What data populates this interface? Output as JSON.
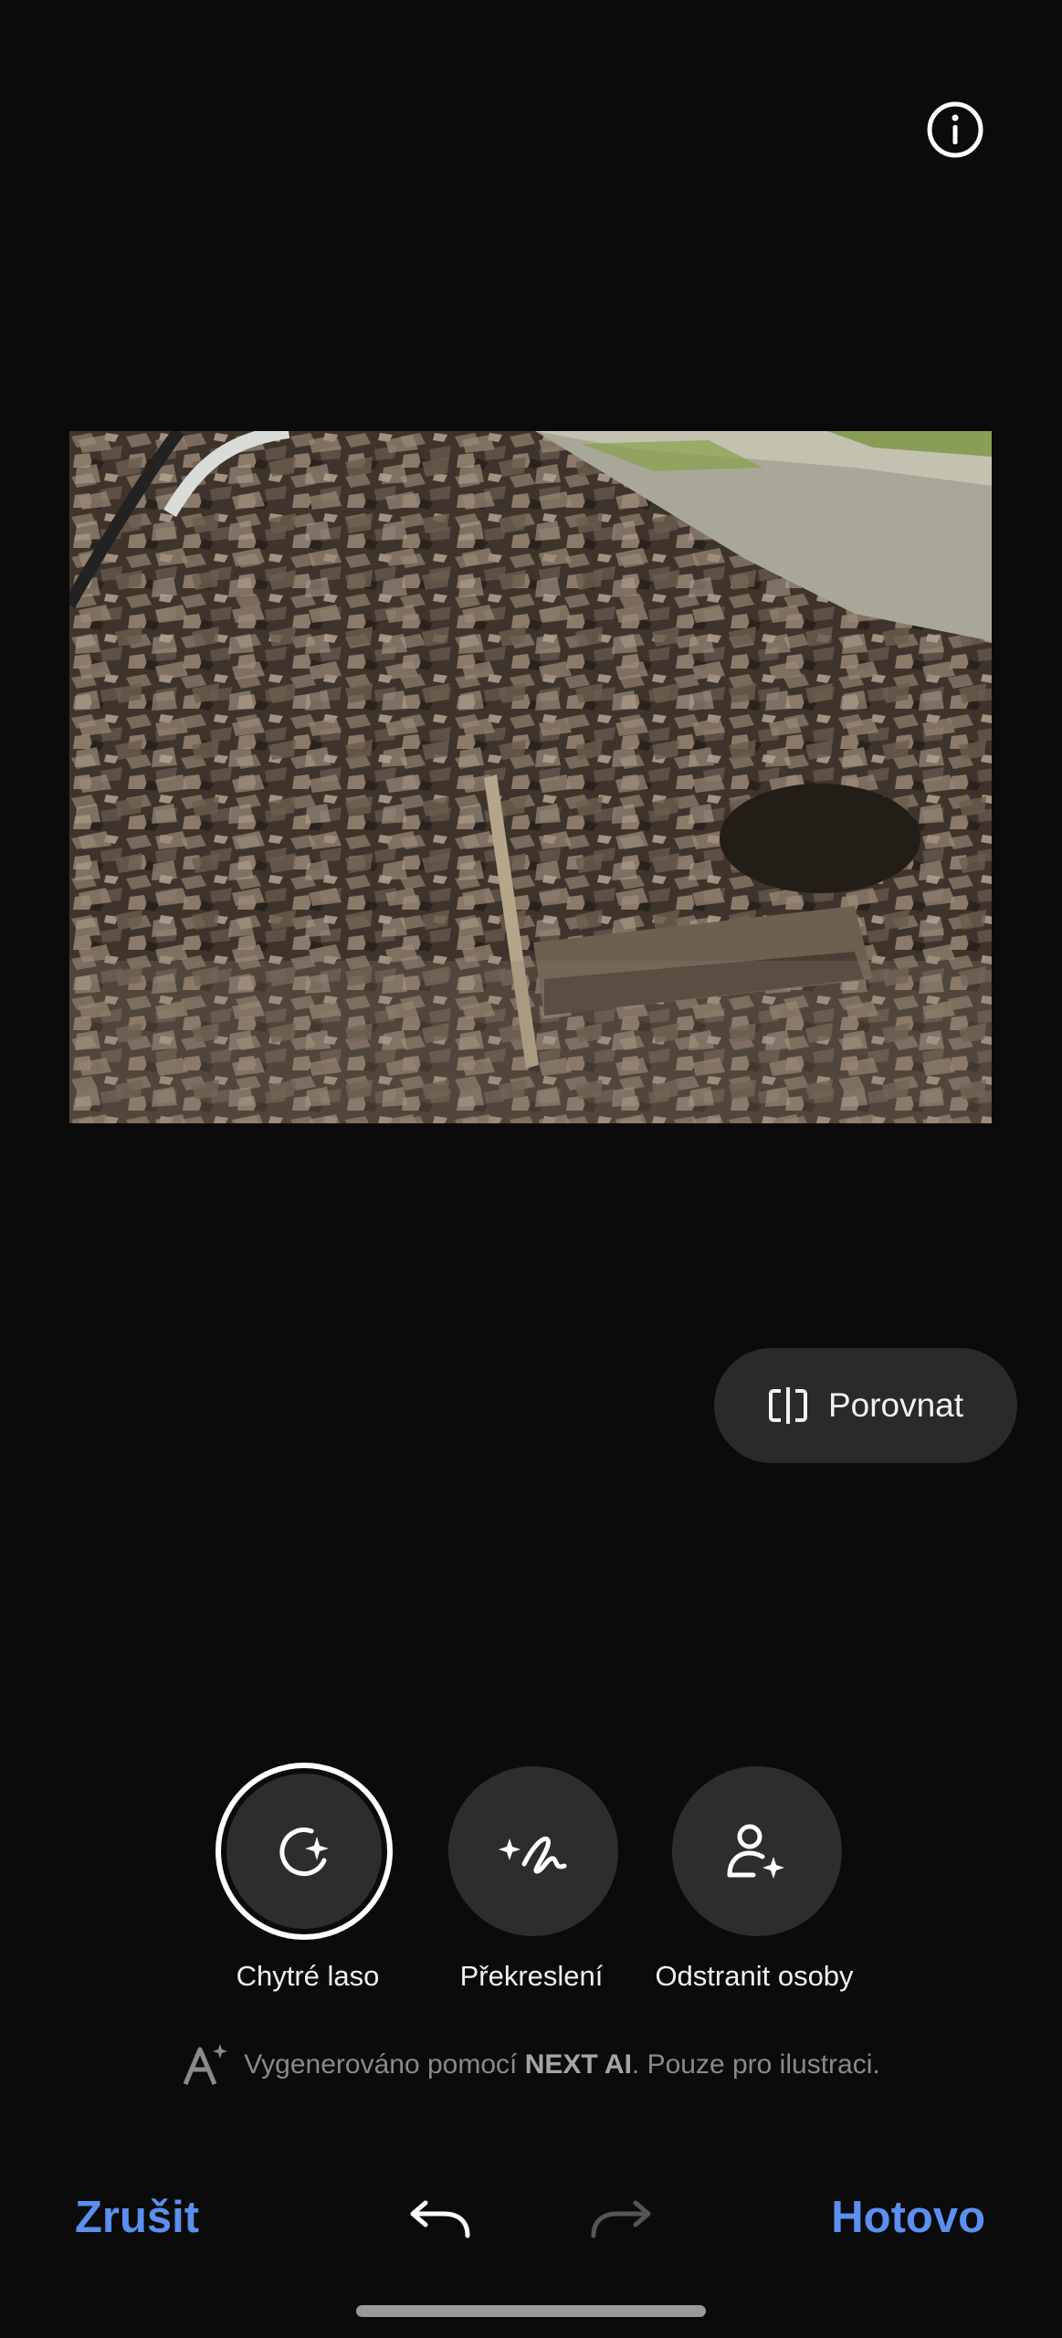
{
  "header": {
    "info_icon": "info-circle-icon"
  },
  "photo": {
    "description_icon": "photo"
  },
  "compare": {
    "label": "Porovnat",
    "icon": "compare-split-icon"
  },
  "tools": [
    {
      "label": "Chytré laso",
      "icon": "smart-lasso-icon",
      "selected": true
    },
    {
      "label": "Překreslení",
      "icon": "redraw-sparkle-icon",
      "selected": false
    },
    {
      "label": "Odstranit osoby",
      "icon": "remove-person-icon",
      "selected": false
    }
  ],
  "ai_note": {
    "prefix": "Vygenerováno pomocí ",
    "brand": "NEXT AI",
    "suffix": ". Pouze pro ilustraci."
  },
  "bottom": {
    "cancel_label": "Zrušit",
    "done_label": "Hotovo",
    "accent": "#5b8ff0"
  }
}
